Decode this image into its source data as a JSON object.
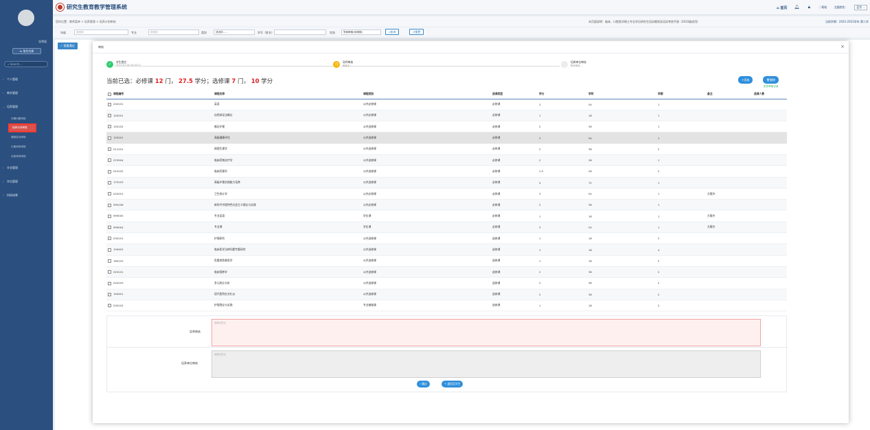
{
  "sidebar": {
    "user_role": "导师组",
    "switch_role": "角色切换",
    "search_placeholder": "Search...",
    "menu": [
      {
        "label": "个人管理"
      },
      {
        "label": "教学管理"
      },
      {
        "label": "培养管理"
      }
    ],
    "sub_items": [
      "开题问题审核",
      "培养计划审核",
      "课程变动审核",
      "中期考核审核",
      "实践考核审核"
    ],
    "menu_after": [
      {
        "label": "毕业管理"
      },
      {
        "label": "学位管理"
      },
      {
        "label": "科研成果"
      }
    ]
  },
  "topbar": {
    "title": "研究生教育教学管理系统",
    "home": "首页",
    "help": "帮助",
    "theme_label": "主题颜色：",
    "theme_value": "蓝色"
  },
  "crumbbar": {
    "crumb": "您的位置：教师菜单 > 培养管理 > 培养计划审核",
    "notice": "本页面说明：临床、口腔医学硕士专业学位研究生培训细则及培训考核手册（2022级适用）",
    "term": "当前学期：2022-2023学年 第二学"
  },
  "filters": {
    "grade_label": "年级",
    "grade_placeholder": "请选择",
    "major_label": "专业",
    "major_placeholder": "请选择",
    "type_label": "类别",
    "type_placeholder": "请选择......",
    "stuno_label": "学号（姓名）",
    "status_label": "状态",
    "status_value": "导师审核(待审核)",
    "query": "查询",
    "reset": "重置"
  },
  "batch_button": "✓ 批量通过",
  "modal": {
    "title": "审核",
    "steps": [
      {
        "name": "学生提交",
        "sub": "2023-07-26 16:18:11"
      },
      {
        "name": "导师审核",
        "sub": "审核中..."
      },
      {
        "name": "培养单位审核",
        "sub": "等待审核..."
      }
    ],
    "summary": {
      "prefix": "当前已选：必修课",
      "req_count": "12",
      "mid1": "门，",
      "req_credits": "27.5",
      "mid2": "学分；选修课",
      "opt_count": "7",
      "mid3": "门，",
      "opt_credits": "10",
      "suffix": "学分"
    },
    "add": "+添加",
    "del": "删除",
    "history": "历史审核记录",
    "columns": [
      "课程编号",
      "课程名称",
      "课程类别",
      "选课类型",
      "学分",
      "学时",
      "学期",
      "备注",
      "选课人数"
    ],
    "rows": [
      [
        "200101",
        "英语",
        "公共必修课",
        "必修课",
        "3",
        "54",
        "1",
        ""
      ],
      [
        "100201",
        "自然辩证法概论",
        "公共必修课",
        "必修课",
        "1",
        "18",
        "1",
        ""
      ],
      [
        "150102",
        "循证护理",
        "公共选修课",
        "必修课",
        "2",
        "36",
        "1",
        ""
      ],
      [
        "120201",
        "高级健康评估",
        "公共选修课",
        "必修课",
        "3",
        "54",
        "1",
        ""
      ],
      [
        "011201",
        "病理生理学",
        "公共选修课",
        "必修课",
        "2",
        "36",
        "2",
        ""
      ],
      [
        "070504",
        "临床药物治疗学",
        "公共选修课",
        "必修课",
        "2",
        "36",
        "1",
        ""
      ],
      [
        "010102",
        "临床药理学",
        "公共选修课",
        "必修课",
        "1.5",
        "28",
        "2",
        ""
      ],
      [
        "170103",
        "高级护理实践能力培养",
        "公共选修课",
        "必修课",
        "4",
        "72",
        "1",
        ""
      ],
      [
        "020201",
        "卫生统计学",
        "公共必修课",
        "必修课",
        "3",
        "54",
        "1",
        "方案外"
      ],
      [
        "590106",
        "新时代中国特色社会主义理论与实践",
        "公共必修课",
        "必修课",
        "2",
        "36",
        "1",
        ""
      ],
      [
        "999005",
        "专业英语",
        "学位课",
        "必修课",
        "1",
        "18",
        "1",
        "方案外"
      ],
      [
        "999004",
        "专业课",
        "学位课",
        "必修课",
        "3",
        "54",
        "1",
        "方案外"
      ],
      [
        "030101",
        "护理研究",
        "公共选修课",
        "选修课",
        "1",
        "18",
        "2",
        ""
      ],
      [
        "100402",
        "临床医学法律问题专题研究",
        "公共选修课",
        "选修课",
        "1",
        "18",
        "4",
        ""
      ],
      [
        "160103",
        "危重病急救医学",
        "公共选修课",
        "选修课",
        "1",
        "18",
        "2",
        ""
      ],
      [
        "020101",
        "临床营养学",
        "公共选修课",
        "选修课",
        "2",
        "36",
        "2",
        ""
      ],
      [
        "020203",
        "多元统计分析",
        "公共选修课",
        "选修课",
        "2",
        "36",
        "2",
        ""
      ],
      [
        "100401",
        "现代医院社交礼仪",
        "公共选修课",
        "选修课",
        "2",
        "36",
        "2",
        ""
      ],
      [
        "030102",
        "护理理论与实践",
        "专业基础课",
        "选修课",
        "1",
        "18",
        "2",
        ""
      ]
    ],
    "review": {
      "mentor_label": "导师审核",
      "mentor_placeholder": "请填写意见",
      "unit_label": "培养单位审核",
      "unit_placeholder": "请填写意见"
    },
    "ok": "✓通过",
    "back": "↰ 退回至学生"
  }
}
